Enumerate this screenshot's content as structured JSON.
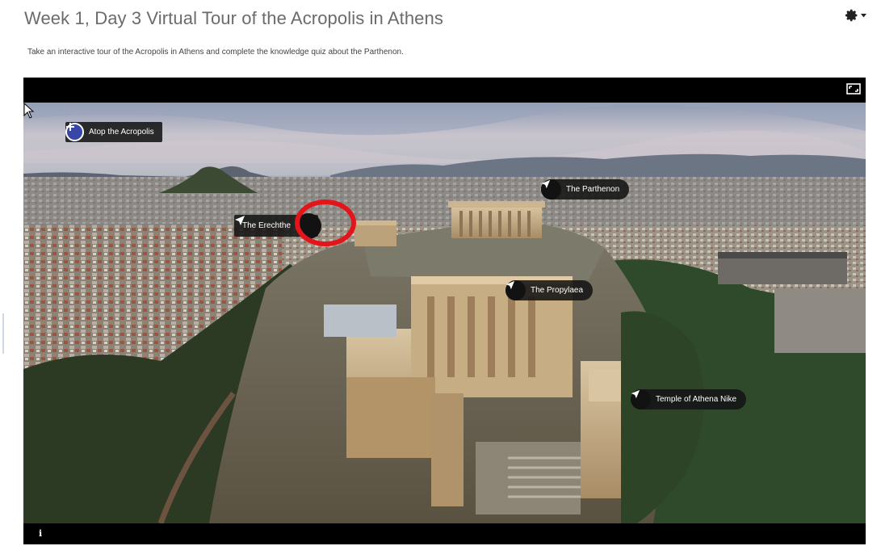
{
  "page": {
    "title": "Week 1, Day 3 Virtual Tour of the Acropolis in Athens",
    "description": "Take an interactive tour of the Acropolis in Athens and complete the knowledge quiz about the Parthenon."
  },
  "header": {
    "settings_icon": "gear-icon",
    "settings_caret": "chevron-down-icon"
  },
  "viewer": {
    "fullscreen_icon": "fullscreen-icon",
    "info_label": "i",
    "hotspots": {
      "atop": {
        "label": "Atop the Acropolis",
        "icon": "plus-icon"
      },
      "erechtheion": {
        "label": "The Erechthe",
        "icon": "navigation-arrow-icon"
      },
      "parthenon": {
        "label": "The Parthenon",
        "icon": "navigation-arrow-icon"
      },
      "propylaea": {
        "label": "The Propylaea",
        "icon": "navigation-arrow-icon"
      },
      "nike": {
        "label": "Temple of Athena Nike",
        "icon": "navigation-arrow-icon"
      }
    },
    "highlight_color": "#e3151b",
    "scene_description_colors": {
      "sky": "#c0c4d0",
      "city": "#8a8477",
      "rock": "#6d6a5c",
      "marble": "#c8b08a"
    }
  }
}
